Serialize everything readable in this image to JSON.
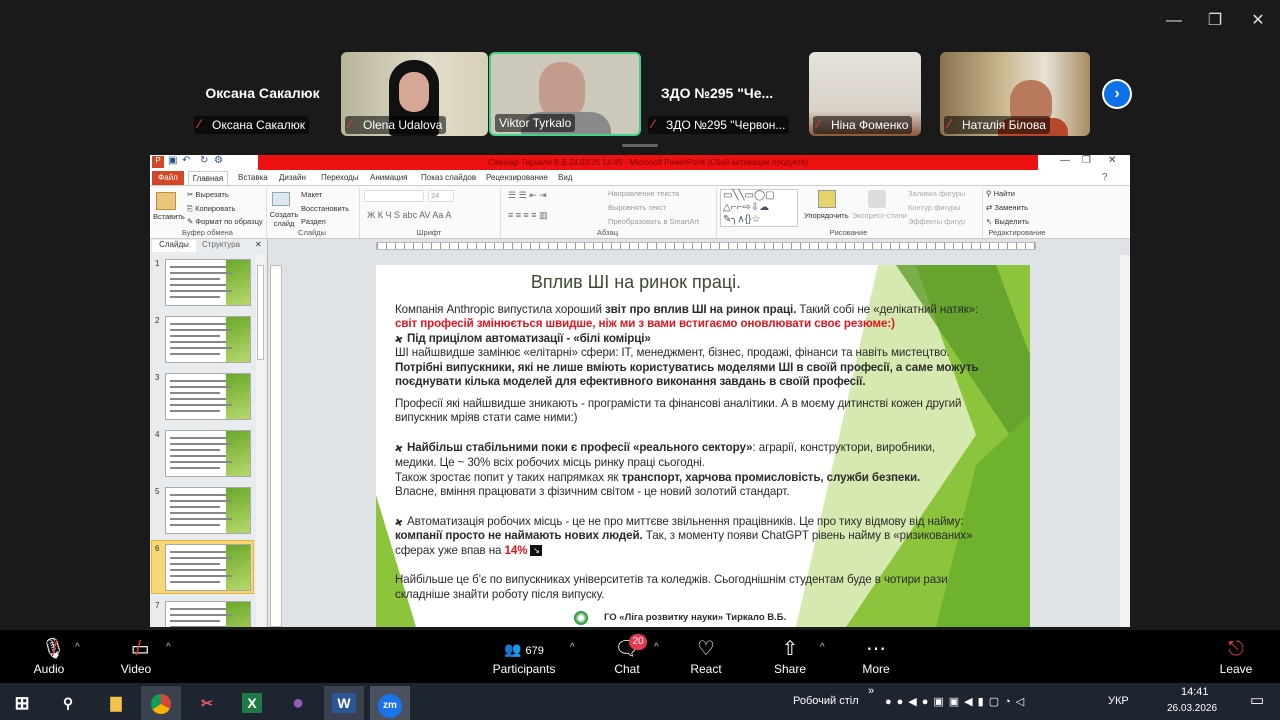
{
  "window_controls": {
    "minimize": "—",
    "restore": "❐",
    "close": "✕"
  },
  "participants": [
    {
      "display": "Оксана Сакалюк",
      "label": "Оксана Сакалюк",
      "video": false
    },
    {
      "label": "Olena Udalova",
      "video": true
    },
    {
      "label": "Viktor Tyrkalo",
      "video": true,
      "active_speaker": true
    },
    {
      "display": "ЗДО №295 \"Че...",
      "label": "ЗДО №295 \"Червон...",
      "video": false
    },
    {
      "label": "Ніна Фоменко",
      "video": true
    },
    {
      "label": "Наталія Білова",
      "video": true
    }
  ],
  "next_page_icon": "chevron-right-icon",
  "ppt": {
    "title": "Семінар Тиркало В.Б 24.03.26 14:45 - Microsoft PowerPoint (Сбой активации продукта)",
    "tabs": [
      "Файл",
      "Главная",
      "Вставка",
      "Дизайн",
      "Переходы",
      "Анимация",
      "Показ слайдов",
      "Рецензирование",
      "Вид"
    ],
    "active_tab": "Главная",
    "ribbon": {
      "paste": "Вставить",
      "cut": "Вырезать",
      "copy": "Копировать",
      "format_painter": "Формат по образцу",
      "clipboard": "Буфер обмена",
      "new_slide": "Создать слайд",
      "layout": "Макет",
      "reset": "Восстановить",
      "section": "Раздел",
      "slides": "Слайды",
      "font_size": "24",
      "font": "Шрифт",
      "font_buttons": "Ж  К  Ч  S  abc  AV  Aa  A",
      "text_direction": "Направление текста",
      "align_text": "Выровнять текст",
      "smartart": "Преобразовать в SmartArt",
      "paragraph": "Абзац",
      "arrange": "Упорядочить",
      "quick_styles": "Экспресс-стили",
      "fill": "Заливка фигуры",
      "outline": "Контур фигуры",
      "effects": "Эффекты фигур",
      "drawing": "Рисование",
      "find": "Найти",
      "replace": "Заменить",
      "select": "Выделить",
      "editing": "Редактирование"
    },
    "pane_tabs": [
      "Слайды",
      "Структура"
    ],
    "slide_numbers": [
      "1",
      "2",
      "3",
      "4",
      "5",
      "6",
      "7"
    ],
    "selected_slide": 6
  },
  "slide": {
    "title": "Вплив ШІ на ринок праці.",
    "lines": [
      [
        {
          "t": "Компанія Anthropic випустила хороший "
        },
        {
          "t": "звіт про вплив ШІ на ринок праці.",
          "b": true
        },
        {
          "t": " Такий собі не «делікатний натяк»:"
        }
      ],
      [
        {
          "t": "світ професій змінюється швидше, ніж ми з вами встигаємо оновлювати своє резюме:)",
          "b": true,
          "red": true
        }
      ],
      [
        {
          "t": "Під прицілом автоматизації - «білі комірці»",
          "b": true,
          "pin": true
        }
      ],
      [
        {
          "t": "ШІ найшвидше замінює «елітарні» сфери: IT, менеджмент, бізнес, продажі, фінанси та навіть мистецтво."
        }
      ],
      [
        {
          "t": "Потрібні випускники, які не лише вміють користуватись моделями ШІ в своїй професії, а саме можуть",
          "b": true
        }
      ],
      [
        {
          "t": "поєднувати кілька моделей для ефективного виконання завдань в своїй професії.",
          "b": true
        }
      ],
      [
        {
          "t": "Професії які найшвидше зникають - програмісти та фінансові аналітики.  А в моєму дитинстві кожен другий"
        }
      ],
      [
        {
          "t": "випускник мріяв стати саме ними:)"
        }
      ],
      [
        {
          "t": "Найбільш стабільними поки є професії «реального сектору»",
          "b": true,
          "pin": true
        },
        {
          "t": ": аграрії, конструктори, виробники,"
        }
      ],
      [
        {
          "t": "медики. Це ~ 30% всіх робочих місць ринку праці сьогодні."
        }
      ],
      [
        {
          "t": "Також зростає попит у таких напрямках як "
        },
        {
          "t": "транспорт, харчова промисловість, служби безпеки.",
          "b": true
        }
      ],
      [
        {
          "t": "Власне, вміння працювати з фізичним світом - це новий золотий стандарт."
        }
      ],
      [
        {
          "t": "Автоматизація робочих місць - це не про миттєве звільнення працівників. Це про тиху відмову від найму:",
          "pin": true
        }
      ],
      [
        {
          "t": "компанії просто не наймають нових людей.",
          "b": true
        },
        {
          "t": " Так, з моменту появи ChatGPT рівень найму в «ризикованих»"
        }
      ],
      [
        {
          "t": "сферах уже впав на "
        },
        {
          "t": "14%",
          "b": true,
          "red": true,
          "chart_icon": true
        }
      ],
      [
        {
          "t": "Найбільше це б'є по випускниках університетів та коледжів. Сьогоднішнім студентам буде в чотири рази"
        }
      ],
      [
        {
          "t": "складніше знайти роботу після випуску."
        }
      ]
    ],
    "footer": "ГО «Ліга розвитку науки»   Тиркало В.Б."
  },
  "toolbar": {
    "audio": "Audio",
    "video": "Video",
    "participants": "Participants",
    "participants_count": "679",
    "chat": "Chat",
    "chat_badge": "20",
    "react": "React",
    "share": "Share",
    "more": "More",
    "leave": "Leave"
  },
  "taskbar": {
    "desktop": "Робочий стіл",
    "lang": "УКР",
    "time": "14:41",
    "date": "26.03.2026",
    "apps": [
      "windows-start",
      "search",
      "file-explorer",
      "chrome",
      "snipping-tool",
      "excel",
      "viber",
      "word",
      "zoom"
    ]
  },
  "colors": {
    "title_bar": "#ee1111",
    "active_speaker": "#3fd68a",
    "muted": "#e0393e",
    "chat_badge": "#e8384f",
    "slide_green": "#7ab800"
  }
}
